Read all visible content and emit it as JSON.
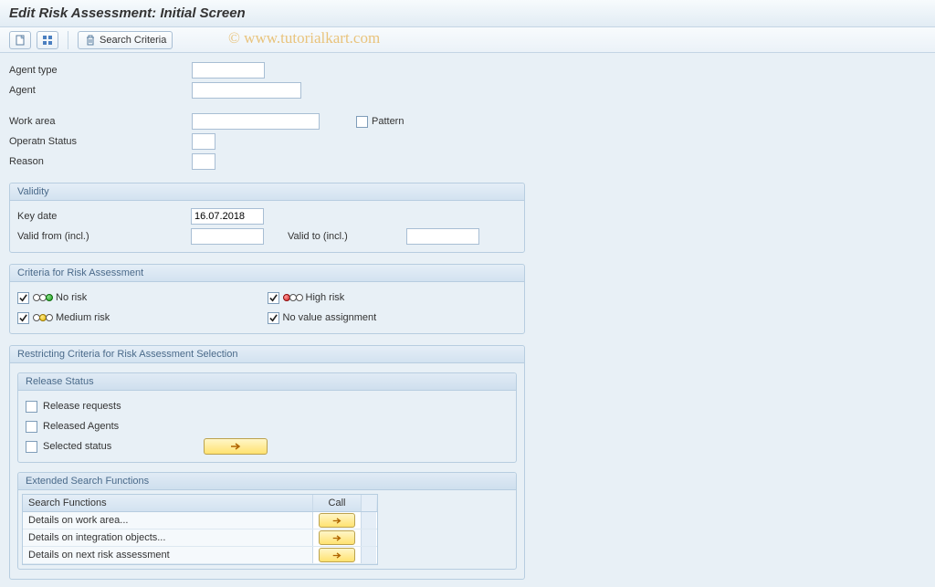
{
  "title": "Edit Risk Assessment: Initial Screen",
  "watermark": "© www.tutorialkart.com",
  "toolbar": {
    "search_criteria_label": "Search Criteria"
  },
  "top_form": {
    "agent_type_label": "Agent type",
    "agent_type_value": "",
    "agent_label": "Agent",
    "agent_value": "",
    "work_area_label": "Work area",
    "work_area_value": "",
    "pattern_label": "Pattern",
    "operatn_status_label": "Operatn Status",
    "operatn_status_value": "",
    "reason_label": "Reason",
    "reason_value": ""
  },
  "validity": {
    "title": "Validity",
    "key_date_label": "Key date",
    "key_date_value": "16.07.2018",
    "valid_from_label": "Valid from (incl.)",
    "valid_from_value": "",
    "valid_to_label": "Valid to (incl.)",
    "valid_to_value": ""
  },
  "criteria": {
    "title": "Criteria for Risk Assessment",
    "no_risk_label": "No risk",
    "high_risk_label": "High risk",
    "medium_risk_label": "Medium risk",
    "no_value_label": "No value assignment"
  },
  "restricting": {
    "title": "Restricting Criteria for Risk Assessment Selection",
    "release_status_title": "Release Status",
    "release_requests_label": "Release requests",
    "released_agents_label": "Released Agents",
    "selected_status_label": "Selected status",
    "extended_title": "Extended Search Functions",
    "col_functions": "Search Functions",
    "col_call": "Call",
    "rows": [
      "Details on work area...",
      "Details on integration objects...",
      "Details on next risk assessment"
    ]
  }
}
